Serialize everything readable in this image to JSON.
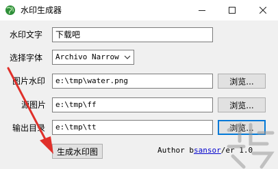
{
  "window": {
    "title": "水印生成器"
  },
  "form": {
    "watermark_text": {
      "label": "水印文字",
      "value": "下载吧"
    },
    "font": {
      "label": "选择字体",
      "selected": "Archivo Narrow"
    },
    "watermark_image": {
      "label": "图片水印",
      "value": "e:\\tmp\\water.png",
      "browse_label": "浏览..."
    },
    "source_image": {
      "label": "源图片",
      "value": "e:\\tmp\\ff",
      "browse_label": "浏览..."
    },
    "output_dir": {
      "label": "输出目录",
      "value": "e:\\tmp\\tt",
      "browse_label": "浏览..."
    }
  },
  "actions": {
    "generate_label": "生成水印图"
  },
  "footer": {
    "author_prefix": "Author b",
    "author_link": "sansor",
    "author_suffix": "/er 1.0"
  },
  "colors": {
    "annotation_arrow": "#e0302a",
    "focus_border": "#0078d7",
    "link": "#0000cc"
  },
  "icons": {
    "app": "globe-icon",
    "minimize": "minimize-icon",
    "maximize": "maximize-icon",
    "close": "close-icon",
    "dropdown": "chevron-down-icon"
  }
}
